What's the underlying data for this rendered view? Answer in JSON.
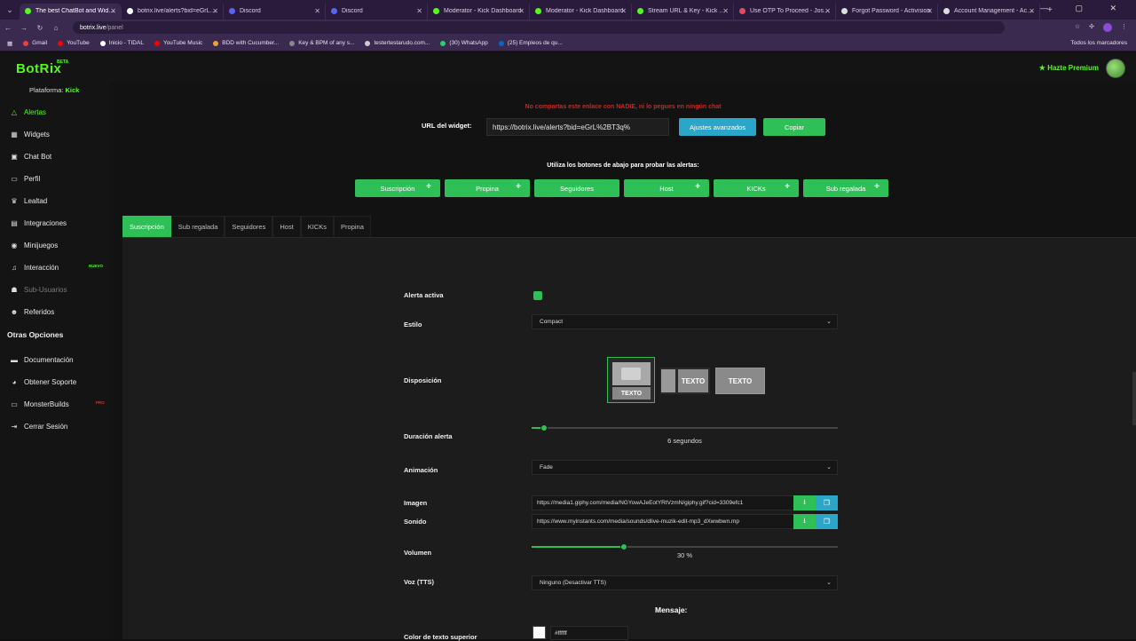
{
  "browser": {
    "tabs": [
      {
        "title": "The best ChatBot and Widgets",
        "color": "#53fc18",
        "active": true
      },
      {
        "title": "botrix.live/alerts?bid=eGrL%2",
        "color": "#ffffff",
        "active": false
      },
      {
        "title": "Discord",
        "color": "#5865f2",
        "active": false
      },
      {
        "title": "Discord",
        "color": "#5865f2",
        "active": false
      },
      {
        "title": "Moderator - Kick Dashboard",
        "color": "#53fc18",
        "active": false
      },
      {
        "title": "Moderator - Kick Dashboard",
        "color": "#53fc18",
        "active": false
      },
      {
        "title": "Stream URL & Key - Kick Dash",
        "color": "#53fc18",
        "active": false
      },
      {
        "title": "Use OTP To Proceed - Jossi54",
        "color": "#e04f5f",
        "active": false
      },
      {
        "title": "Forgot Password - Activision",
        "color": "#dddddd",
        "active": false
      },
      {
        "title": "Account Management - Activi",
        "color": "#dddddd",
        "active": false
      }
    ],
    "new_tab": "+",
    "window_controls": "— ▢ ✕",
    "url_host": "botrix.live",
    "url_path": "/panel",
    "bookmarks": [
      {
        "label": "Gmail",
        "color": "#ea4335"
      },
      {
        "label": "YouTube",
        "color": "#ff0000"
      },
      {
        "label": "Inicio - TIDAL",
        "color": "#ffffff"
      },
      {
        "label": "YouTube Music",
        "color": "#ff0000"
      },
      {
        "label": "BDD with Cucumber...",
        "color": "#f0a030"
      },
      {
        "label": "Key & BPM of any s...",
        "color": "#888888"
      },
      {
        "label": "testertestarudo.com...",
        "color": "#cccccc"
      },
      {
        "label": "(30) WhatsApp",
        "color": "#25d366"
      },
      {
        "label": "(25) Empleos de qu...",
        "color": "#0a66c2"
      }
    ],
    "bookmarks_all": "Todos los marcadores"
  },
  "app": {
    "logo": "BotRix",
    "logo_badge": "BETA",
    "premium_label": "★ Hazte Premium",
    "platform_label": "Plataforma:",
    "platform_value": "Kick"
  },
  "sidebar": {
    "items": [
      {
        "label": "Alertas",
        "icon": "△",
        "state": "active"
      },
      {
        "label": "Widgets",
        "icon": "▦",
        "state": ""
      },
      {
        "label": "Chat Bot",
        "icon": "▣",
        "state": ""
      },
      {
        "label": "Perfil",
        "icon": "▭",
        "state": ""
      },
      {
        "label": "Lealtad",
        "icon": "♛",
        "state": ""
      },
      {
        "label": "Integraciones",
        "icon": "▤",
        "state": ""
      },
      {
        "label": "Minijuegos",
        "icon": "◉",
        "state": ""
      },
      {
        "label": "Interacción",
        "icon": "♫",
        "state": "",
        "badge": "NUEVO"
      },
      {
        "label": "Sub-Usuarios",
        "icon": "☗",
        "state": "disabled"
      },
      {
        "label": "Referidos",
        "icon": "☻",
        "state": ""
      }
    ],
    "section_title": "Otras Opciones",
    "other_items": [
      {
        "label": "Documentación",
        "icon": "▬"
      },
      {
        "label": "Obtener Soporte",
        "icon": "◕"
      },
      {
        "label": "MonsterBuilds",
        "icon": "▭",
        "badge": "PRO"
      },
      {
        "label": "Cerrar Sesión",
        "icon": "⇥"
      }
    ]
  },
  "main": {
    "warning": "No compartas este enlace con NADIE, ni lo pegues en ningún chat",
    "url_label": "URL del widget:",
    "url_value": "https://botrix.live/alerts?bid=eGrL%2BT3q%",
    "advanced_button": "Ajustes avanzados",
    "copy_button": "Copiar",
    "test_instructions": "Utiliza los botones de abajo para probar las alertas:",
    "test_buttons": [
      {
        "label": "Suscripción",
        "plus": true
      },
      {
        "label": "Propina",
        "plus": true
      },
      {
        "label": "Seguidores",
        "plus": false
      },
      {
        "label": "Host",
        "plus": true
      },
      {
        "label": "KICKs",
        "plus": true
      },
      {
        "label": "Sub regalada",
        "plus": true
      }
    ],
    "tabs": [
      "Suscripción",
      "Sub regalada",
      "Seguidores",
      "Host",
      "KICKs",
      "Propina"
    ],
    "active_tab": 0
  },
  "form": {
    "alert_active_label": "Alerta activa",
    "alert_active_checked": true,
    "style_label": "Estilo",
    "style_value": "Compact",
    "layout_label": "Disposición",
    "layout_option_text": "TEXTO",
    "duration_label": "Duración alerta",
    "duration_value": "6",
    "duration_unit": "segundos",
    "duration_max_seconds": 150,
    "animation_label": "Animación",
    "animation_value": "Fade",
    "image_label": "Imagen",
    "image_value": "https://media1.giphy.com/media/NGYowAJeEotYRtVzmN/giphy.gif?cid=3309efc1",
    "sound_label": "Sonido",
    "sound_value": "https://www.myinstants.com/media/sounds/dlive-muzik-edit-mp3_dXwwbwn.mp",
    "volume_label": "Volumen",
    "volume_value": "30",
    "volume_unit": "%",
    "volume_fraction": 0.3,
    "tts_label": "Voz (TTS)",
    "tts_value": "Ninguno (Desactivar TTS)",
    "message_title": "Mensaje:",
    "top_color_label": "Color de texto superior",
    "top_color_value": "#ffffff",
    "upload_icon": "⭳",
    "gallery_icon": "❐"
  },
  "colors": {
    "accent": "#2fbf57",
    "brand": "#53fc18",
    "info": "#2aa6c9",
    "warning": "#c62828"
  }
}
